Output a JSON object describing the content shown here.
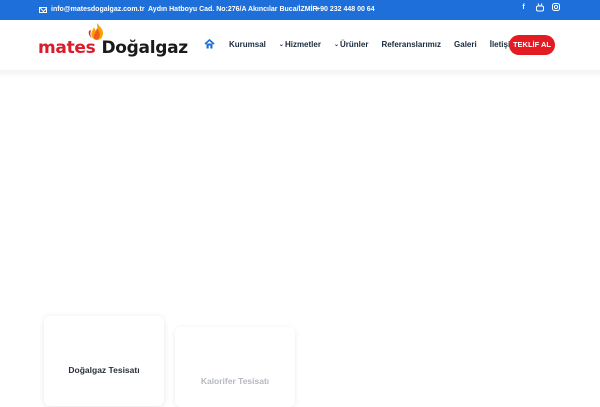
{
  "topbar": {
    "email": "info@matesdogalgaz.com.tr",
    "address": "Aydın Hatboyu Cad. No:276/A Akıncılar Buca/İZMİR",
    "phone": "+90 232 448 00 64",
    "social": [
      "facebook-icon",
      "youtube-icon",
      "instagram-icon"
    ],
    "bg_color": "#1e6fd9"
  },
  "logo": {
    "brand": "mates",
    "name": "Doğalgaz",
    "brand_color": "#d91d2a"
  },
  "nav": {
    "items": [
      {
        "label": "Kurumsal",
        "dropdown": false
      },
      {
        "label": "Hizmetler",
        "dropdown": true
      },
      {
        "label": "Ürünler",
        "dropdown": true
      },
      {
        "label": "Referanslarımız",
        "dropdown": false
      },
      {
        "label": "Galeri",
        "dropdown": false
      },
      {
        "label": "İletişim",
        "dropdown": false
      }
    ],
    "cta": "TEKLİF AL",
    "cta_color": "#e31b23"
  },
  "cards": [
    {
      "title": "Doğalgaz Tesisatı"
    },
    {
      "title": "Kalorifer Tesisatı"
    }
  ]
}
